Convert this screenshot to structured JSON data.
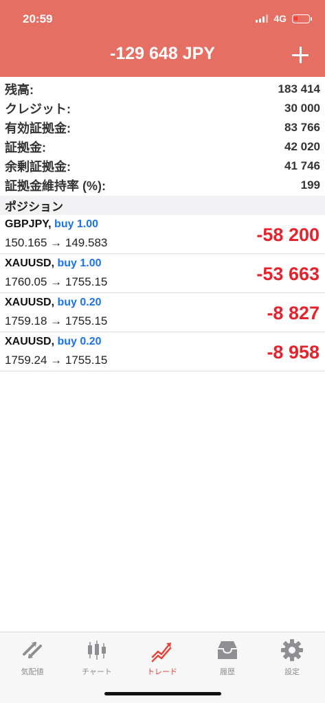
{
  "status_bar": {
    "time": "20:59",
    "network": "4G"
  },
  "header": {
    "balance_title": "-129 648 JPY"
  },
  "summary": [
    {
      "label": "残高:",
      "value": "183 414"
    },
    {
      "label": "クレジット:",
      "value": "30 000"
    },
    {
      "label": "有効証拠金:",
      "value": "83 766"
    },
    {
      "label": "証拠金:",
      "value": "42 020"
    },
    {
      "label": "余剰証拠金:",
      "value": "41 746"
    },
    {
      "label": "証拠金維持率 (%):",
      "value": "199"
    }
  ],
  "positions_section": {
    "title": "ポジション"
  },
  "positions": [
    {
      "symbol": "GBPJPY,",
      "type": "buy 1.00",
      "prices": "150.165 → 149.583",
      "profit": "-58 200"
    },
    {
      "symbol": "XAUUSD,",
      "type": "buy 1.00",
      "prices": "1760.05 → 1755.15",
      "profit": "-53 663"
    },
    {
      "symbol": "XAUUSD,",
      "type": "buy 0.20",
      "prices": "1759.18 → 1755.15",
      "profit": "-8 827"
    },
    {
      "symbol": "XAUUSD,",
      "type": "buy 0.20",
      "prices": "1759.24 → 1755.15",
      "profit": "-8 958"
    }
  ],
  "tabs": [
    {
      "label": "気配値",
      "icon": "quotes-icon"
    },
    {
      "label": "チャート",
      "icon": "chart-icon"
    },
    {
      "label": "トレード",
      "icon": "trade-icon",
      "active": true
    },
    {
      "label": "履歴",
      "icon": "history-icon"
    },
    {
      "label": "設定",
      "icon": "settings-icon"
    }
  ],
  "colors": {
    "header": "#e46f62",
    "loss": "#e8212a",
    "buy": "#1a73e8",
    "active_tab": "#e2453a"
  }
}
